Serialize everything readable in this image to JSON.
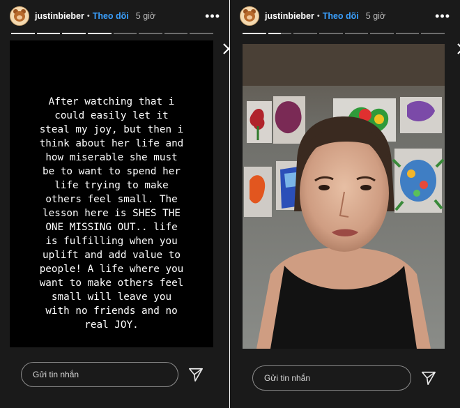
{
  "stories": [
    {
      "username": "justinbieber",
      "separator": "•",
      "follow_label": "Theo dõi",
      "time": "5 giờ",
      "more_label": "•••",
      "progress": [
        1,
        1,
        1,
        1,
        0,
        0,
        0,
        0
      ],
      "text": "After watching that i\ncould easily let it\nsteal my joy, but then i\nthink about her life and\nhow miserable she must\nbe to want to spend her\nlife trying to make\nothers feel small. The\nlesson here is SHES THE\nONE MISSING OUT.. life\nis fulfilling when you\nuplift and add value to\npeople! A life where you\nwant to make others feel\nsmall will leave you\nwith no friends and no\nreal JOY.",
      "reply_placeholder": "Gửi tin nhắn"
    },
    {
      "username": "justinbieber",
      "separator": "•",
      "follow_label": "Theo dõi",
      "time": "5 giờ",
      "more_label": "•••",
      "progress": [
        1,
        0.55,
        0,
        0,
        0,
        0,
        0,
        0
      ],
      "reply_placeholder": "Gửi tin nhắn"
    }
  ],
  "icons": {
    "close": "close-icon",
    "send": "send-icon",
    "more": "more-icon"
  },
  "colors": {
    "background": "#1a1a1a",
    "follow": "#3aa0ff",
    "input_border": "#8b8b8b"
  }
}
